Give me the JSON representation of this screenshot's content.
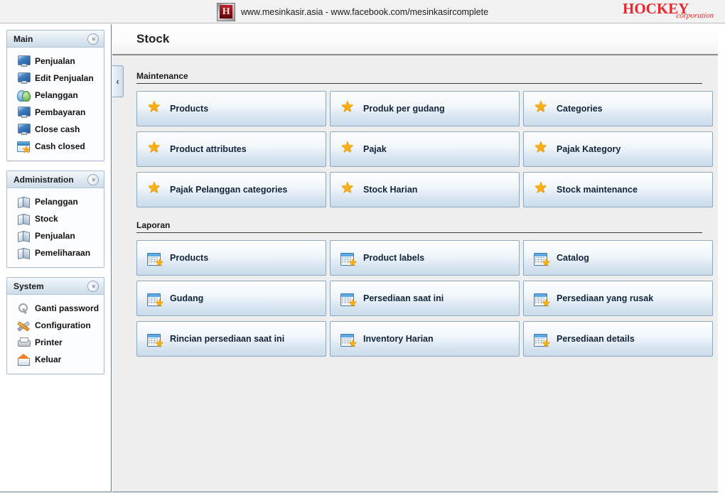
{
  "banner": {
    "logo_letter": "H",
    "logo_icon": "h-square-logo",
    "text": "www.mesinkasir.asia - www.facebook.com/mesinkasircomplete",
    "brand_main": "HOCKEY",
    "brand_sub": "corporation"
  },
  "sidebar": {
    "collapse_tab": "‹",
    "panels": [
      {
        "title": "Main",
        "collapse_glyph": "«",
        "items": [
          {
            "label": "Penjualan",
            "icon": "monitor-icon"
          },
          {
            "label": "Edit Penjualan",
            "icon": "monitor-icon"
          },
          {
            "label": "Pelanggan",
            "icon": "users-icon"
          },
          {
            "label": "Pembayaran",
            "icon": "monitor-icon"
          },
          {
            "label": "Close cash",
            "icon": "monitor-icon"
          },
          {
            "label": "Cash closed",
            "icon": "grid-star-icon"
          }
        ]
      },
      {
        "title": "Administration",
        "collapse_glyph": "«",
        "items": [
          {
            "label": "Pelanggan",
            "icon": "book-icon"
          },
          {
            "label": "Stock",
            "icon": "book-icon"
          },
          {
            "label": "Penjualan",
            "icon": "book-icon"
          },
          {
            "label": "Pemeliharaan",
            "icon": "book-icon"
          }
        ]
      },
      {
        "title": "System",
        "collapse_glyph": "«",
        "items": [
          {
            "label": "Ganti password",
            "icon": "key-icon"
          },
          {
            "label": "Configuration",
            "icon": "tools-icon"
          },
          {
            "label": "Printer",
            "icon": "printer-icon"
          },
          {
            "label": "Keluar",
            "icon": "home-exit-icon"
          }
        ]
      }
    ]
  },
  "main": {
    "title": "Stock",
    "sections": [
      {
        "label": "Maintenance",
        "icon": "star-icon",
        "tiles": [
          "Products",
          "Produk per gudang",
          "Categories",
          "Product attributes",
          "Pajak",
          "Pajak Kategory",
          "Pajak Pelanggan categories",
          "Stock Harian",
          "Stock maintenance"
        ]
      },
      {
        "label": "Laporan",
        "icon": "report-icon",
        "tiles": [
          "Products",
          "Product labels",
          "Catalog",
          "Gudang",
          "Persediaan saat ini",
          "Persediaan yang rusak",
          "Rincian persediaan saat ini",
          "Inventory Harian",
          "Persediaan details"
        ]
      }
    ]
  },
  "colors": {
    "brand_red": "#e8272d",
    "tile_border": "#8fa7bd",
    "content_bg": "#eeeeee",
    "star_gold": "#f9b018",
    "panel_header": "#dde8f1"
  }
}
